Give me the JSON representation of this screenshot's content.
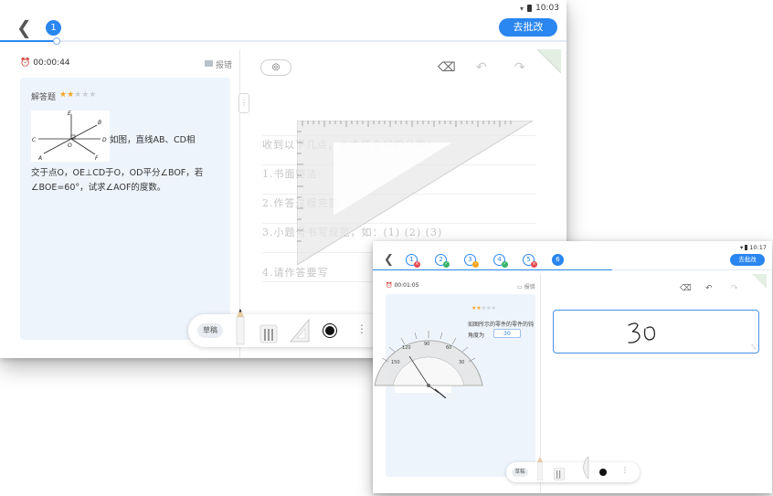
{
  "back_screen": {
    "status_time": "10:03",
    "question_number": "1",
    "grade_button": "去批改",
    "timer": "00:00:44",
    "report_label": "报错",
    "question_type": "解答题",
    "difficulty_stars": "★★",
    "difficulty_stars_off": "★★★",
    "question_text_1": "如图，直线AB、CD相",
    "question_text_2": "交于点O，OE⊥CD于O，OD平分∠BOF，若",
    "question_text_3": "∠BOE=60°，试求∠AOF的度数。",
    "figure_labels": {
      "E": "E",
      "B": "B",
      "C": "C",
      "D": "D",
      "O": "O",
      "A": "A",
      "F": "F"
    },
    "notebook_lines": [
      "收到以下几点，小主您会好的分数：",
      "1.书面整洁",
      "2.作答过程完整",
      "3.小题号书写规范，如：(1) (2) (3)",
      "4.请作答要写"
    ],
    "toolbar_draft": "草稿",
    "progress": 0.1
  },
  "front_screen": {
    "status_time": "10:17",
    "question_numbers": [
      {
        "n": "1",
        "mark": "wrong"
      },
      {
        "n": "2",
        "mark": "right"
      },
      {
        "n": "3",
        "mark": "partial"
      },
      {
        "n": "4",
        "mark": "right"
      },
      {
        "n": "5",
        "mark": "wrong"
      },
      {
        "n": "6",
        "mark": "none"
      }
    ],
    "grade_button": "去批改",
    "timer": "00:01:05",
    "report_label": "报错",
    "difficulty_stars": "★★",
    "difficulty_stars_off": "★★★",
    "question_fragment_1": "如图所示的零件的零件的钝",
    "question_fragment_2": "角度为",
    "inline_answer": "30",
    "handwritten_answer": "30",
    "toolbar_draft": "草稿",
    "progress": 0.6
  },
  "colors": {
    "accent": "#2a86f0",
    "card_bg": "#eef4fb",
    "star": "#f5a623"
  }
}
